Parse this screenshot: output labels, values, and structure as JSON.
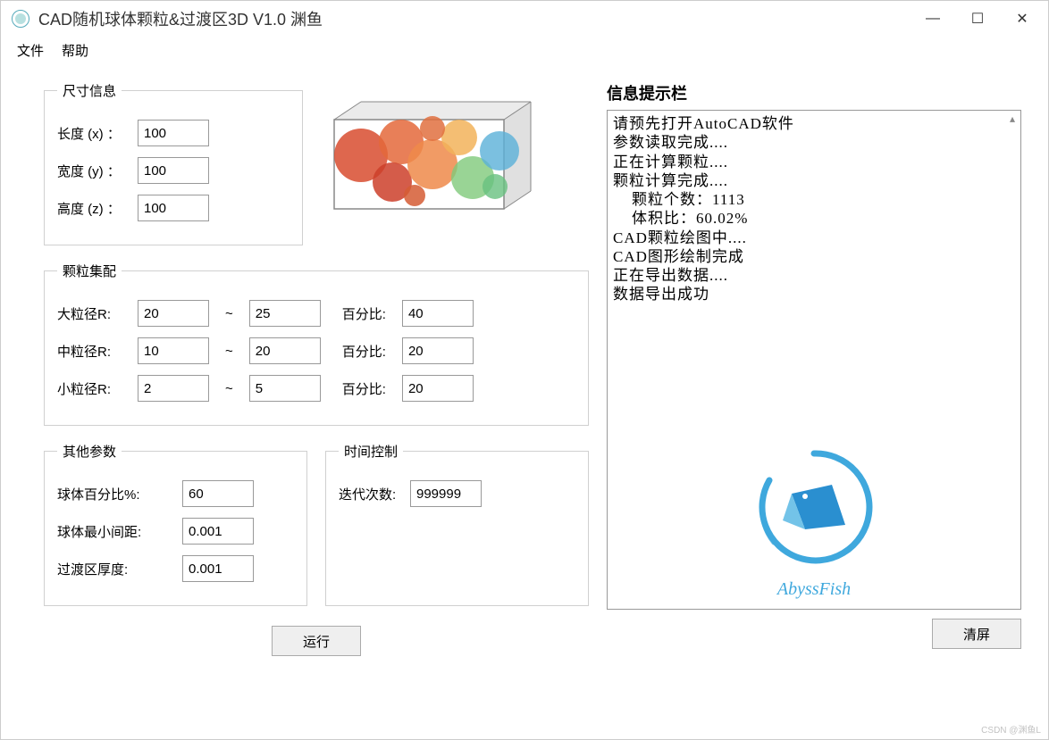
{
  "window": {
    "title": "CAD随机球体颗粒&过渡区3D V1.0 渊鱼"
  },
  "menu": {
    "file": "文件",
    "help": "帮助"
  },
  "size": {
    "legend": "尺寸信息",
    "length_label": "长度 (x) ：",
    "length": "100",
    "width_label": "宽度 (y) ：",
    "width": "100",
    "height_label": "高度 (z) ：",
    "height": "100"
  },
  "grading": {
    "legend": "颗粒集配",
    "rows": [
      {
        "label": "大粒径R:",
        "min": "20",
        "max": "25",
        "pct": "40"
      },
      {
        "label": "中粒径R:",
        "min": "10",
        "max": "20",
        "pct": "20"
      },
      {
        "label": "小粒径R:",
        "min": "2",
        "max": "5",
        "pct": "20"
      }
    ],
    "pct_label": "百分比:"
  },
  "other": {
    "legend": "其他参数",
    "sphere_pct_label": "球体百分比%:",
    "sphere_pct": "60",
    "min_gap_label": "球体最小间距:",
    "min_gap": "0.001",
    "itz_label": "过渡区厚度:",
    "itz": "0.001"
  },
  "time": {
    "legend": "时间控制",
    "iter_label": "迭代次数:",
    "iter": "999999"
  },
  "buttons": {
    "run": "运行",
    "clear": "清屏"
  },
  "info": {
    "title": "信息提示栏",
    "text": "请预先打开AutoCAD软件\n参数读取完成....\n正在计算颗粒....\n颗粒计算完成....\n    颗粒个数：1113\n    体积比：60.02%\nCAD颗粒绘图中....\nCAD图形绘制完成\n正在导出数据....\n数据导出成功"
  },
  "logo": {
    "text": "AbyssFish"
  },
  "footer": "CSDN @渊鱼L"
}
